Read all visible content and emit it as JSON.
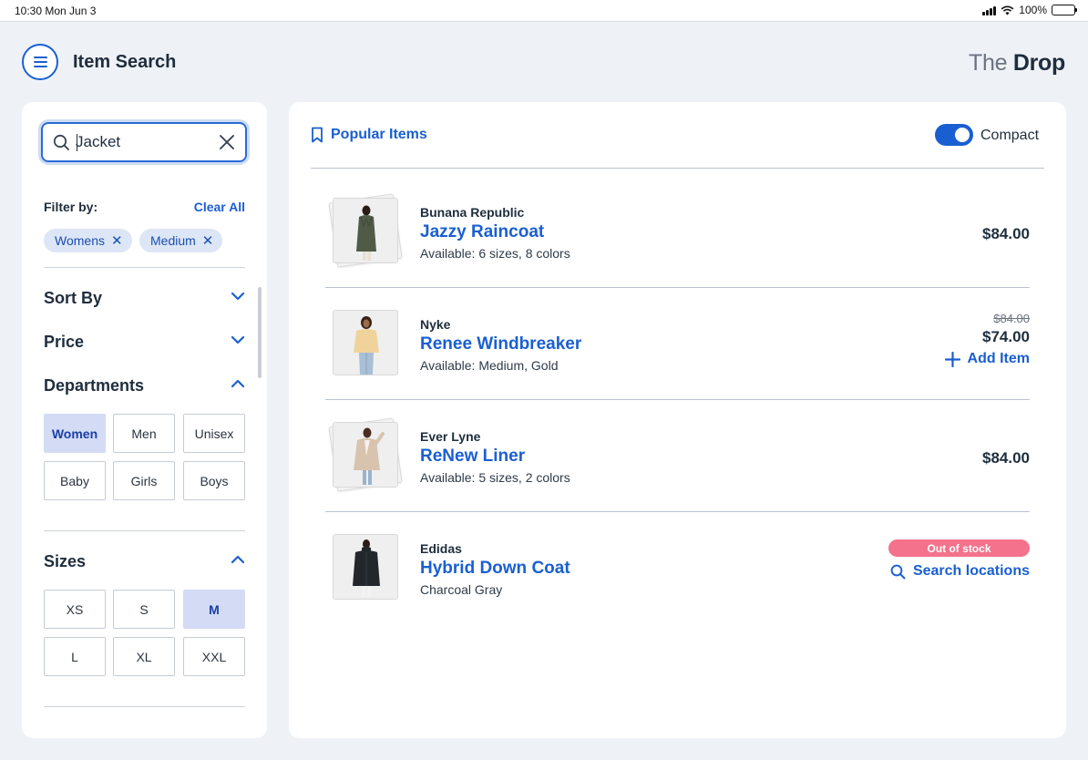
{
  "status_bar": {
    "time": "10:30 Mon Jun 3",
    "battery": "100%"
  },
  "header": {
    "title": "Item Search",
    "brand_prefix": "The",
    "brand_suffix": "Drop",
    "menu_icon": "hamburger-menu-icon"
  },
  "search": {
    "value": "Jacket",
    "placeholder": "",
    "search_icon": "magnifier-icon",
    "clear_icon": "close-icon"
  },
  "filters": {
    "label": "Filter by:",
    "clear_all": "Clear All",
    "chips": [
      {
        "label": "Womens"
      },
      {
        "label": "Medium"
      }
    ]
  },
  "sections": {
    "sort_by": {
      "label": "Sort By",
      "expanded": false
    },
    "price": {
      "label": "Price",
      "expanded": false
    },
    "departments": {
      "label": "Departments",
      "expanded": true,
      "options": [
        {
          "label": "Women",
          "selected": true
        },
        {
          "label": "Men",
          "selected": false
        },
        {
          "label": "Unisex",
          "selected": false
        },
        {
          "label": "Baby",
          "selected": false
        },
        {
          "label": "Girls",
          "selected": false
        },
        {
          "label": "Boys",
          "selected": false
        }
      ]
    },
    "sizes": {
      "label": "Sizes",
      "expanded": true,
      "options": [
        {
          "label": "XS",
          "selected": false
        },
        {
          "label": "S",
          "selected": false
        },
        {
          "label": "M",
          "selected": true
        },
        {
          "label": "L",
          "selected": false
        },
        {
          "label": "XL",
          "selected": false
        },
        {
          "label": "XXL",
          "selected": false
        }
      ]
    }
  },
  "results": {
    "heading": "Popular Items",
    "heading_icon": "bookmark-icon",
    "compact_label": "Compact",
    "compact_on": true,
    "items": [
      {
        "brand": "Bunana Republic",
        "name": "Jazzy Raincoat",
        "availability": "Available: 6 sizes, 8 colors",
        "price": "$84.00"
      },
      {
        "brand": "Nyke",
        "name": "Renee Windbreaker",
        "availability": "Available: Medium, Gold",
        "old_price": "$84.00",
        "price": "$74.00",
        "action": "Add Item"
      },
      {
        "brand": "Ever Lyne",
        "name": "ReNew Liner",
        "availability": "Available: 5 sizes, 2 colors",
        "price": "$84.00"
      },
      {
        "brand": "Edidas",
        "name": "Hybrid Down Coat",
        "availability": "Charcoal Gray",
        "badge": "Out of stock",
        "action": "Search locations"
      }
    ]
  },
  "colors": {
    "accent": "#1a5fd1",
    "selected_bg": "#d3dbf5",
    "chip_bg": "#dce6f6",
    "out_of_stock": "#f4728b"
  }
}
